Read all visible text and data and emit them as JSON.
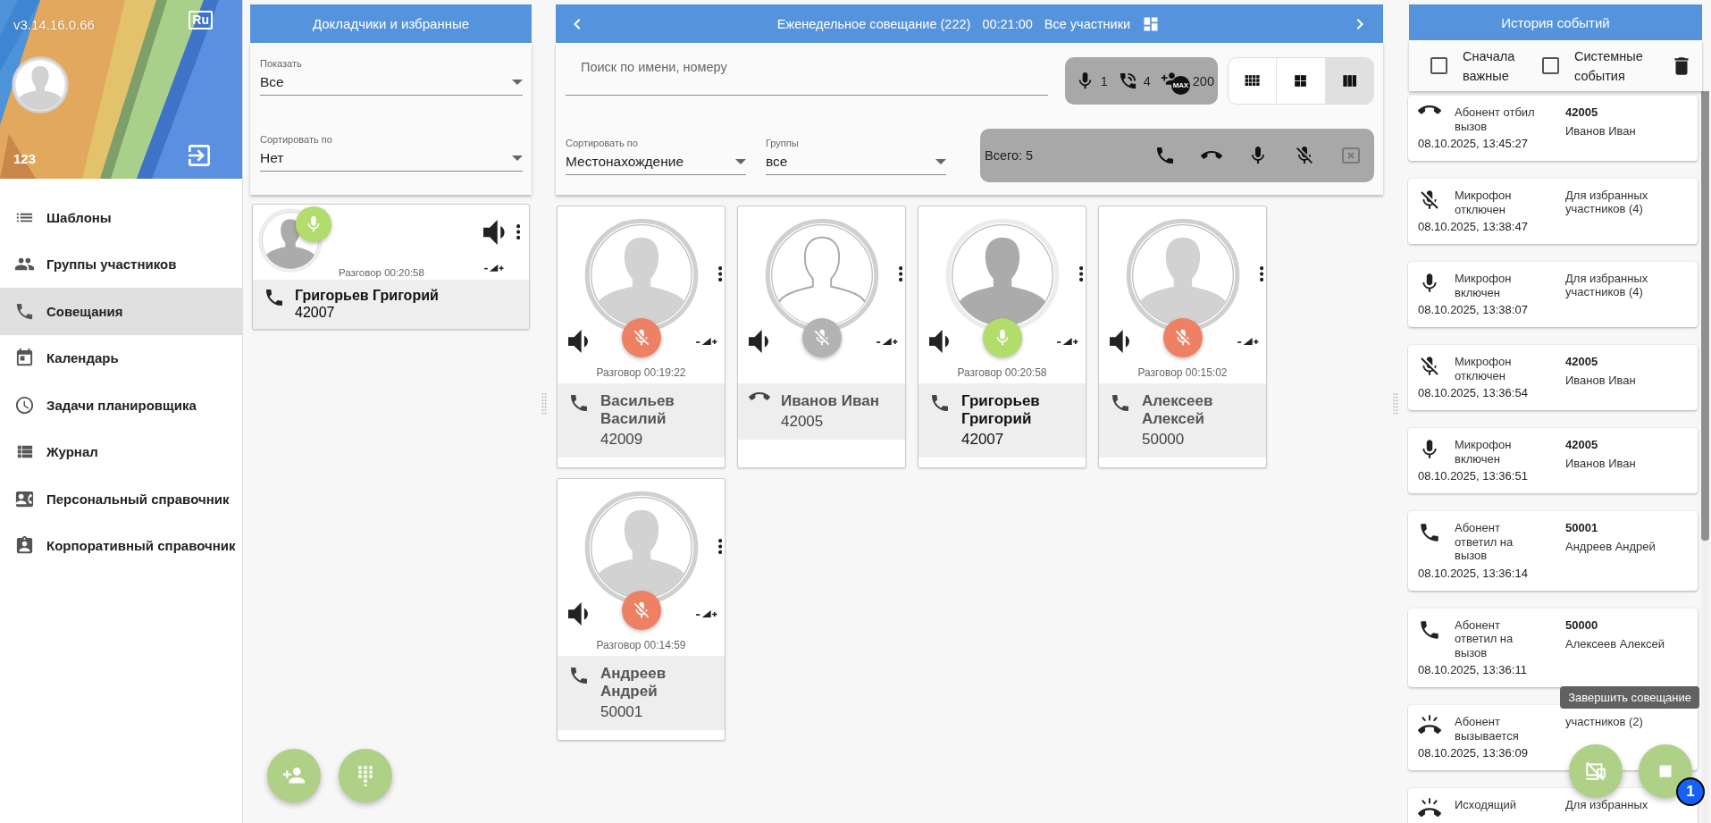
{
  "sidebar": {
    "version": "v3.14.16.0.66",
    "language": "Ru",
    "user_number": "123",
    "items": [
      {
        "label": "Шаблоны",
        "selected": false
      },
      {
        "label": "Группы участников",
        "selected": false
      },
      {
        "label": "Совещания",
        "selected": true
      },
      {
        "label": "Календарь",
        "selected": false
      },
      {
        "label": "Задачи планировщика",
        "selected": false
      },
      {
        "label": "Журнал",
        "selected": false
      },
      {
        "label": "Персональный справочник",
        "selected": false
      },
      {
        "label": "Корпоративный справочник",
        "selected": false
      }
    ]
  },
  "favorites": {
    "title": "Докладчики и избранные",
    "filters": [
      {
        "label": "Показать",
        "value": "Все"
      },
      {
        "label": "Сортировать по",
        "value": "Нет"
      }
    ],
    "participants": [
      {
        "name": "Григорьев Григорий",
        "number": "42007",
        "timer": "Разговор 00:20:58",
        "connected": true,
        "muted": false,
        "speaking": true
      }
    ],
    "fabs": [
      {
        "kind": "add_person"
      },
      {
        "kind": "dialpad"
      }
    ]
  },
  "conference": {
    "title": "Еженедельное совещание (222)",
    "duration": "00:21:00",
    "scope": "Все участники",
    "search": {
      "placeholder": "Поиск по имени, номеру"
    },
    "counters": [
      {
        "kind": "mic",
        "value": "1"
      },
      {
        "kind": "calls",
        "value": "4"
      },
      {
        "kind": "max",
        "badge": "MAX",
        "value": "200"
      }
    ],
    "views": [
      {
        "kind": "small",
        "selected": false
      },
      {
        "kind": "medium",
        "selected": false
      },
      {
        "kind": "large",
        "selected": true
      }
    ],
    "filters": [
      {
        "label": "Сортировать по",
        "value": "Местонахождение"
      },
      {
        "label": "Группы",
        "value": "все"
      }
    ],
    "total": "Всего: 5",
    "actions": [
      {
        "kind": "call",
        "disabled": false
      },
      {
        "kind": "hangup",
        "disabled": false
      },
      {
        "kind": "mic",
        "disabled": false
      },
      {
        "kind": "mic_off",
        "disabled": false
      },
      {
        "kind": "remove",
        "disabled": true
      }
    ],
    "participants": [
      {
        "name": "Васильев Василий",
        "number": "42009",
        "timer": "Разговор 00:19:22",
        "connected": true,
        "muted": true,
        "speaking": false
      },
      {
        "name": "Иванов Иван",
        "number": "42005",
        "connected": false,
        "speaking": false
      },
      {
        "name": "Григорьев Григорий",
        "number": "42007",
        "timer": "Разговор 00:20:58",
        "connected": true,
        "muted": false,
        "speaking": true
      },
      {
        "name": "Алексеев Алексей",
        "number": "50000",
        "timer": "Разговор 00:15:02",
        "connected": true,
        "muted": true,
        "speaking": false
      },
      {
        "name": "Андреев Андрей",
        "number": "50001",
        "timer": "Разговор 00:14:59",
        "connected": true,
        "muted": true,
        "speaking": false
      }
    ]
  },
  "history": {
    "title": "История событий",
    "options": [
      {
        "label": "Сначала важные",
        "checked": false
      },
      {
        "label": "Системные события",
        "checked": false
      }
    ],
    "events": [
      {
        "kind": "declined",
        "text": "Абонент отбил вызов",
        "date": "08.10.2025, 13:45:27",
        "number": "42005",
        "name": "Иванов Иван"
      },
      {
        "kind": "mic_off",
        "text": "Микрофон отключен",
        "date": "08.10.2025, 13:38:47",
        "detail": "Для избранных участников (4)"
      },
      {
        "kind": "mic_on",
        "text": "Микрофон включен",
        "date": "08.10.2025, 13:38:07",
        "detail": "Для избранных участников (4)"
      },
      {
        "kind": "mic_off",
        "text": "Микрофон отключен",
        "date": "08.10.2025, 13:36:54",
        "number": "42005",
        "name": "Иванов Иван"
      },
      {
        "kind": "mic_on",
        "text": "Микрофон включен",
        "date": "08.10.2025, 13:36:51",
        "number": "42005",
        "name": "Иванов Иван"
      },
      {
        "kind": "answered",
        "text": "Абонент ответил на вызов",
        "date": "08.10.2025, 13:36:14",
        "number": "50001",
        "name": "Андреев Андрей"
      },
      {
        "kind": "answered",
        "text": "Абонент ответил на вызов",
        "date": "08.10.2025, 13:36:11",
        "number": "50000",
        "name": "Алексеев Алексей"
      },
      {
        "kind": "calling",
        "text": "Абонент вызывается",
        "date": "08.10.2025, 13:36:09",
        "detail": "участников (2)"
      },
      {
        "kind": "outgoing",
        "text": "Исходящий",
        "detail": "Для избранных"
      }
    ],
    "tooltip": "Завершить совещание",
    "fabs": [
      {
        "kind": "screen_off"
      },
      {
        "kind": "stop",
        "badge": "1"
      }
    ]
  }
}
